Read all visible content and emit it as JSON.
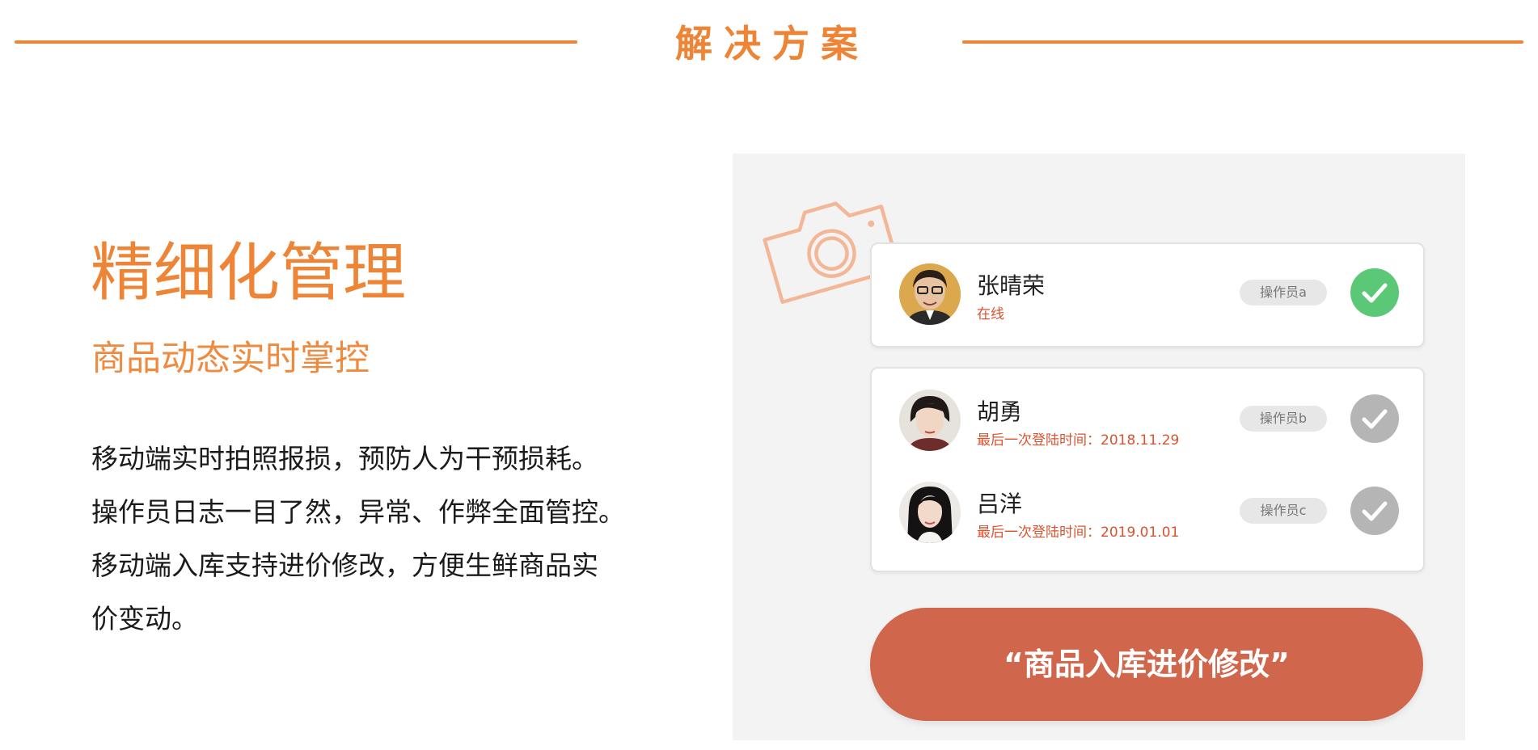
{
  "header": {
    "title": "解决方案",
    "accent_color": "#ed8436"
  },
  "feature": {
    "title": "精细化管理",
    "subtitle": "商品动态实时掌控",
    "description_lines": [
      "移动端实时拍照报损，预防人为干预损耗。",
      "操作员日志一目了然，异常、作弊全面管控。",
      "移动端入库支持进价修改，方便生鲜商品实",
      "价变动。"
    ]
  },
  "mockup": {
    "decoration_icon": "camera-icon",
    "operators": [
      {
        "name": "张晴荣",
        "status": "在线",
        "role": "操作员a",
        "checked": true,
        "check_color": "#5bc878"
      },
      {
        "name": "胡勇",
        "status": "最后一次登陆时间：2018.11.29",
        "role": "操作员b",
        "checked": false,
        "check_color": "#b5b5b5"
      },
      {
        "name": "吕洋",
        "status": "最后一次登陆时间：2019.01.01",
        "role": "操作员c",
        "checked": false,
        "check_color": "#b5b5b5"
      }
    ],
    "action_button": {
      "label": "“商品入库进价修改”",
      "color": "#d0674c"
    }
  }
}
